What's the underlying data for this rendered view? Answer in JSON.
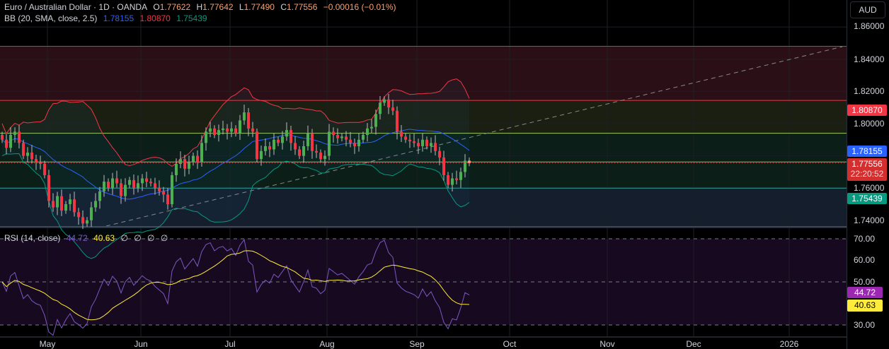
{
  "header": {
    "symbol": "Euro / Australian Dollar · 1D · OANDA",
    "o_label": "O",
    "o": "1.77622",
    "h_label": "H",
    "h": "1.77642",
    "l_label": "L",
    "l": "1.77490",
    "c_label": "C",
    "c": "1.77556",
    "change": "−0.00016 (−0.01%)"
  },
  "bb": {
    "label": "BB (20, SMA, close, 2.5)",
    "basis": "1.78155",
    "upper": "1.80870",
    "lower": "1.75439"
  },
  "rsi": {
    "label": "RSI (14, close)",
    "value": "44.72",
    "ma": "40.63",
    "extras": [
      "∅",
      "∅",
      "∅",
      "∅"
    ]
  },
  "axis": {
    "currency": "AUD",
    "price_ticks": [
      "1.86000",
      "1.84000",
      "1.82000",
      "1.80000",
      "1.76000",
      "1.74000"
    ],
    "rsi_ticks": [
      "70.00",
      "60.00",
      "50.00",
      "30.00"
    ],
    "tags": {
      "upper": "1.80870",
      "basis": "1.78155",
      "last": "1.77556",
      "countdown": "22:20:52",
      "lower": "1.75439",
      "rsi": "44.72",
      "rsi_ma": "40.63"
    }
  },
  "time_axis": [
    "May",
    "Jun",
    "Jul",
    "Aug",
    "Sep",
    "Oct",
    "Nov",
    "Dec",
    "2026"
  ],
  "colors": {
    "up": "#4caf50",
    "down": "#f23645",
    "upper": "#f23645",
    "basis": "#2962ff",
    "lower": "#089981",
    "rsi": "#7e57c2",
    "rsi_ma": "#ffeb3b"
  },
  "chart_data": {
    "type": "candlestick",
    "title": "Euro / Australian Dollar · 1D · OANDA",
    "ylim": [
      1.735,
      1.865
    ],
    "rsi_ylim": [
      25,
      75
    ],
    "closes": [
      1.79,
      1.785,
      1.793,
      1.795,
      1.788,
      1.78,
      1.782,
      1.778,
      1.776,
      1.775,
      1.768,
      1.752,
      1.748,
      1.755,
      1.746,
      1.75,
      1.753,
      1.745,
      1.742,
      1.738,
      1.74,
      1.748,
      1.752,
      1.758,
      1.764,
      1.76,
      1.766,
      1.763,
      1.755,
      1.762,
      1.765,
      1.76,
      1.763,
      1.766,
      1.764,
      1.763,
      1.76,
      1.758,
      1.756,
      1.75,
      1.768,
      1.775,
      1.778,
      1.772,
      1.776,
      1.78,
      1.776,
      1.788,
      1.795,
      1.797,
      1.793,
      1.796,
      1.797,
      1.795,
      1.797,
      1.794,
      1.802,
      1.807,
      1.797,
      1.795,
      1.778,
      1.783,
      1.786,
      1.784,
      1.79,
      1.788,
      1.792,
      1.796,
      1.788,
      1.784,
      1.78,
      1.786,
      1.794,
      1.783,
      1.782,
      1.778,
      1.78,
      1.795,
      1.793,
      1.791,
      1.792,
      1.79,
      1.788,
      1.786,
      1.79,
      1.793,
      1.797,
      1.798,
      1.806,
      1.813,
      1.815,
      1.81,
      1.808,
      1.795,
      1.792,
      1.79,
      1.789,
      1.788,
      1.786,
      1.79,
      1.786,
      1.788,
      1.783,
      1.779,
      1.768,
      1.762,
      1.766,
      1.765,
      1.77,
      1.777,
      1.77556
    ],
    "zones": [
      {
        "from": 1.8144,
        "to": 1.848,
        "color": "#2a1016"
      },
      {
        "from": 1.794,
        "to": 1.8144,
        "color": "#1a1f12"
      },
      {
        "from": 1.76,
        "to": 1.794,
        "color": "#0b1e18"
      },
      {
        "from": 1.735,
        "to": 1.76,
        "color": "#141e2c"
      }
    ],
    "levels": [
      {
        "price": 1.848,
        "color": "#b2444f"
      },
      {
        "price": 1.8144,
        "color": "#f23645"
      },
      {
        "price": 1.794,
        "color": "#9ccc65"
      },
      {
        "price": 1.7762,
        "color": "#8bc34a"
      },
      {
        "price": 1.76,
        "color": "#26a69a"
      }
    ],
    "trendline": {
      "from": [
        1.735,
        "start"
      ],
      "to": [
        1.848,
        "end"
      ]
    }
  }
}
